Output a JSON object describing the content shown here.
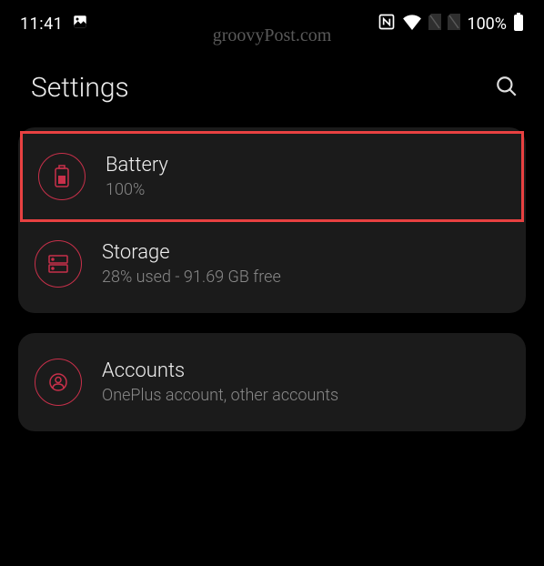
{
  "status_bar": {
    "time": "11:41",
    "battery_pct": "100%"
  },
  "watermark": "groovyPost.com",
  "header": {
    "title": "Settings"
  },
  "sections": {
    "battery": {
      "title": "Battery",
      "sub": "100%"
    },
    "storage": {
      "title": "Storage",
      "sub": "28% used - 91.69 GB free"
    },
    "accounts": {
      "title": "Accounts",
      "sub": "OnePlus account, other accounts"
    }
  }
}
